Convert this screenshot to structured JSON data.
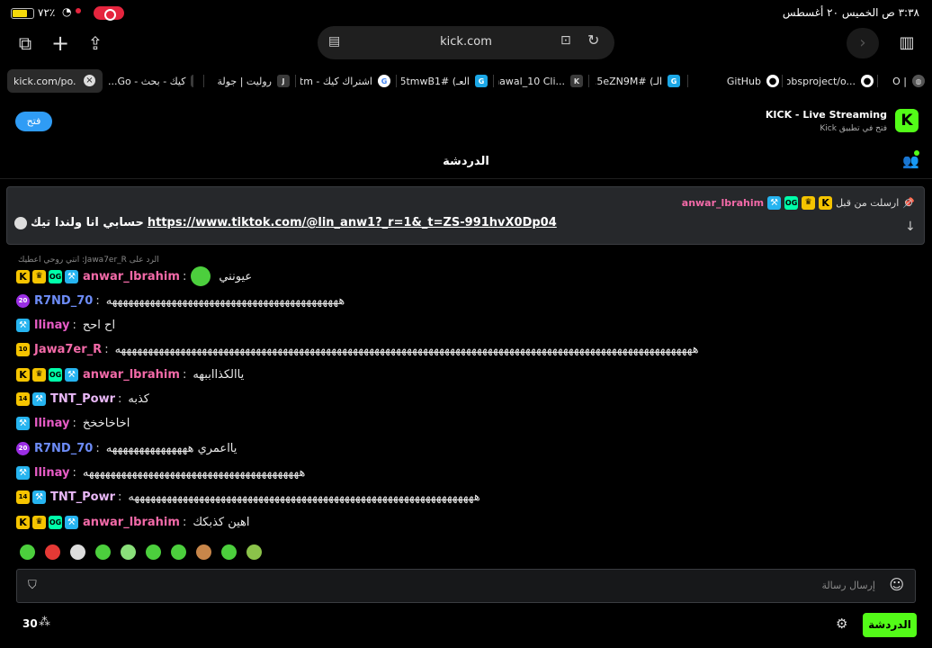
{
  "status_bar": {
    "time_date": "٣:٣٨ ص  الخميس ٢٠ أغسطس",
    "battery_percent": "٧٢٪",
    "battery_level": 0.72
  },
  "browser": {
    "url": "kick.com",
    "tabs": [
      {
        "title": "kick.com/po...",
        "favicon": "",
        "active": true
      },
      {
        "title": "كيك - بحث - Go...",
        "favicon": "G"
      },
      {
        "title": "روليت | جولة",
        "favicon": "J"
      },
      {
        "title": "اشتراك كيك - tm...",
        "favicon": "G"
      },
      {
        "title": "العـ) #5tmwB1...",
        "favicon": "G"
      },
      {
        "title": "nawal_10 Cli...",
        "favicon": "K"
      },
      {
        "title": "الـ) #5eZN9M...",
        "favicon": "G"
      },
      {
        "title": "GitHub",
        "favicon": "github"
      },
      {
        "title": "obsproject/o...",
        "favicon": "github"
      },
      {
        "title": "O |",
        "favicon": "globe"
      }
    ]
  },
  "banner": {
    "title": "KICK - Live Streaming",
    "subtitle": "فتح في تطبيق Kick",
    "open_label": "فتح",
    "logo": "K"
  },
  "chat": {
    "header_title": "الدردشة",
    "pinned": {
      "label": "ارسلت من قبل",
      "user": "anwar_lbrahim",
      "link": "https://www.tiktok.com/@lin_anw1?_r=1&_t=ZS-991hvX0Dp04",
      "text": "حسابي انا ولندا تيك"
    },
    "reply_hint": "الرد على Jawa7er_R: انتي روحي اعطيك",
    "messages": [
      {
        "user": "anwar_lbrahim",
        "color": "#f36aa8",
        "badges": [
          "k",
          "crown",
          "og",
          "mod"
        ],
        "text": "عيونني",
        "emote": true
      },
      {
        "user": "R7ND_70",
        "color": "#6d8cf7",
        "badges": [
          "sub"
        ],
        "text": "هههههههههههههههههههههههههههههههههههههههههههه"
      },
      {
        "user": "llinay",
        "color": "#e85cc7",
        "badges": [
          "mod"
        ],
        "text": "اح احح"
      },
      {
        "user": "Jawa7er_R",
        "color": "#f36aa8",
        "badges": [
          "gift"
        ],
        "text": "هههههههههههههههههههههههههههههههههههههههههههههههههههههههههههههههههههههههههههههههههههههههههههههههههههههههههههه"
      },
      {
        "user": "anwar_lbrahim",
        "color": "#f36aa8",
        "badges": [
          "k",
          "crown",
          "og",
          "mod"
        ],
        "text": "ياالكذااببهه"
      },
      {
        "user": "TNT_Powr",
        "color": "#e9b8f7",
        "badges": [
          "gift14",
          "mod"
        ],
        "text": "كذبه"
      },
      {
        "user": "llinay",
        "color": "#e85cc7",
        "badges": [
          "mod"
        ],
        "text": "اخاخاخخخ"
      },
      {
        "user": "R7ND_70",
        "color": "#6d8cf7",
        "badges": [
          "sub"
        ],
        "text": "يااعمري هههههههههههههههه"
      },
      {
        "user": "llinay",
        "color": "#e85cc7",
        "badges": [
          "mod"
        ],
        "text": "ههههههههههههههههههههههههههههههههههههههههه"
      },
      {
        "user": "TNT_Powr",
        "color": "#e9b8f7",
        "badges": [
          "gift14",
          "mod"
        ],
        "text": "ههههههههههههههههههههههههههههههههههههههههههههههههههههههههههههههههه"
      },
      {
        "user": "anwar_lbrahim",
        "color": "#f36aa8",
        "badges": [
          "k",
          "crown",
          "og",
          "mod"
        ],
        "text": "اهين كذبكك"
      }
    ],
    "badge_texts": {
      "sub": "20",
      "gift": "10",
      "gift14": "14"
    },
    "input_placeholder": "إرسال رسالة",
    "send_label": "الدردشة",
    "viewer_count": "30"
  }
}
